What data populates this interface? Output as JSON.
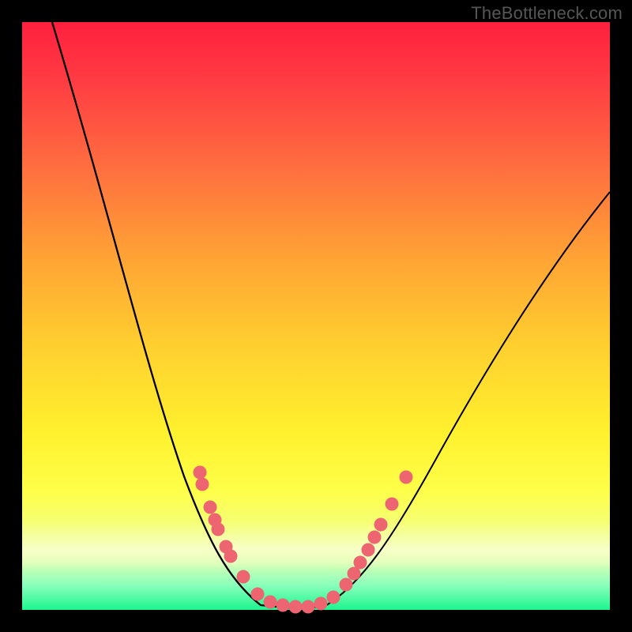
{
  "watermark": "TheBottleneck.com",
  "chart_data": {
    "type": "line",
    "title": "",
    "xlabel": "",
    "ylabel": "",
    "xlim": [
      0,
      100
    ],
    "ylim": [
      0,
      100
    ],
    "background": {
      "gradient_top": "#ff1f3e",
      "gradient_mid": "#fff12e",
      "gradient_bottom": "#1cf58d"
    },
    "series": [
      {
        "name": "left_curve",
        "x": [
          5,
          12,
          18,
          24,
          30,
          35,
          40,
          46
        ],
        "y": [
          100,
          70,
          50,
          35,
          22,
          14,
          6,
          0
        ]
      },
      {
        "name": "right_curve",
        "x": [
          46,
          52,
          58,
          64,
          72,
          82,
          92,
          100
        ],
        "y": [
          0,
          4,
          10,
          20,
          34,
          50,
          64,
          72
        ]
      }
    ],
    "scatter": {
      "name": "markers",
      "color": "#ec6570",
      "x": [
        30,
        31,
        32,
        33,
        33.5,
        35,
        36,
        38,
        40,
        42,
        44,
        46,
        48,
        51,
        53,
        55,
        56.5,
        58,
        59,
        60,
        61,
        63,
        65
      ],
      "y": [
        23,
        21,
        18,
        16,
        14,
        11,
        10,
        6,
        3,
        1.5,
        0.8,
        0.5,
        0.5,
        1,
        2,
        4,
        6,
        8,
        10,
        12,
        14,
        18,
        22
      ]
    },
    "annotations": []
  }
}
